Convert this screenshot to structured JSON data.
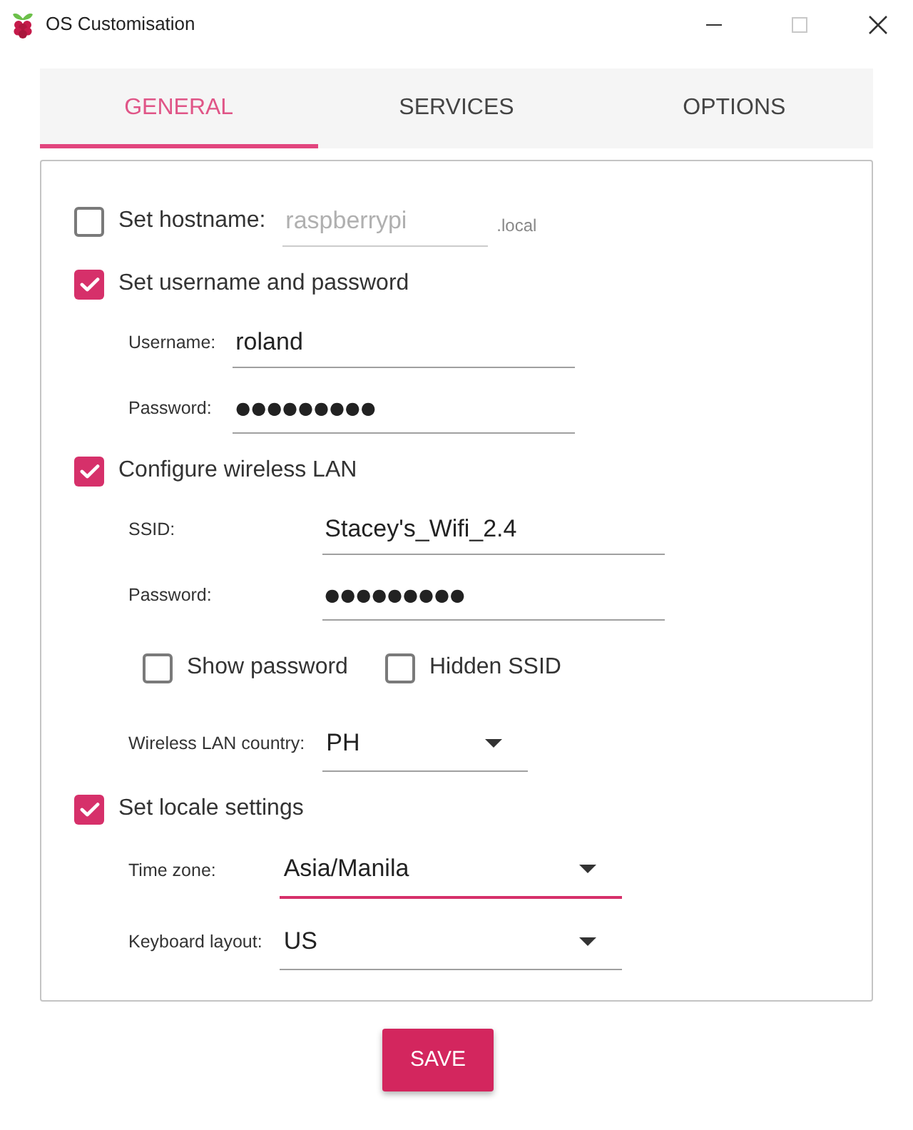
{
  "window": {
    "title": "OS Customisation"
  },
  "tabs": [
    {
      "label": "GENERAL",
      "selected": true
    },
    {
      "label": "SERVICES",
      "selected": false
    },
    {
      "label": "OPTIONS",
      "selected": false
    }
  ],
  "sections": [
    {
      "label": "Set hostname:",
      "checked": false,
      "field": {
        "value": "raspberrypi",
        "suffix": ".local",
        "disabled": true
      }
    },
    {
      "label": "Set username and password",
      "checked": true,
      "fields": [
        {
          "kind": "text",
          "label": "Username:",
          "value": "roland"
        },
        {
          "kind": "password",
          "label": "Password:",
          "value": "●●●●●●●●●"
        }
      ]
    },
    {
      "label": "Configure wireless LAN",
      "checked": true,
      "fields": [
        {
          "kind": "text",
          "label": "SSID:",
          "value": "Stacey's_Wifi_2.4"
        },
        {
          "kind": "password",
          "label": "Password:",
          "value": "●●●●●●●●●"
        },
        {
          "kind": "checkboxes",
          "options": [
            {
              "label": "Show password",
              "checked": false
            },
            {
              "label": "Hidden SSID",
              "checked": false
            }
          ]
        },
        {
          "kind": "compact",
          "label": "Wireless LAN country:",
          "value": "PH",
          "focused": false
        }
      ]
    },
    {
      "label": "Set locale settings",
      "checked": true,
      "fields": [
        {
          "kind": "select",
          "label": "Time zone:",
          "value": "Asia/Manila",
          "focused": true
        },
        {
          "kind": "select",
          "label": "Keyboard layout:",
          "value": "US",
          "focused": false
        }
      ]
    }
  ],
  "buttons": [
    {
      "label": "SAVE"
    }
  ]
}
